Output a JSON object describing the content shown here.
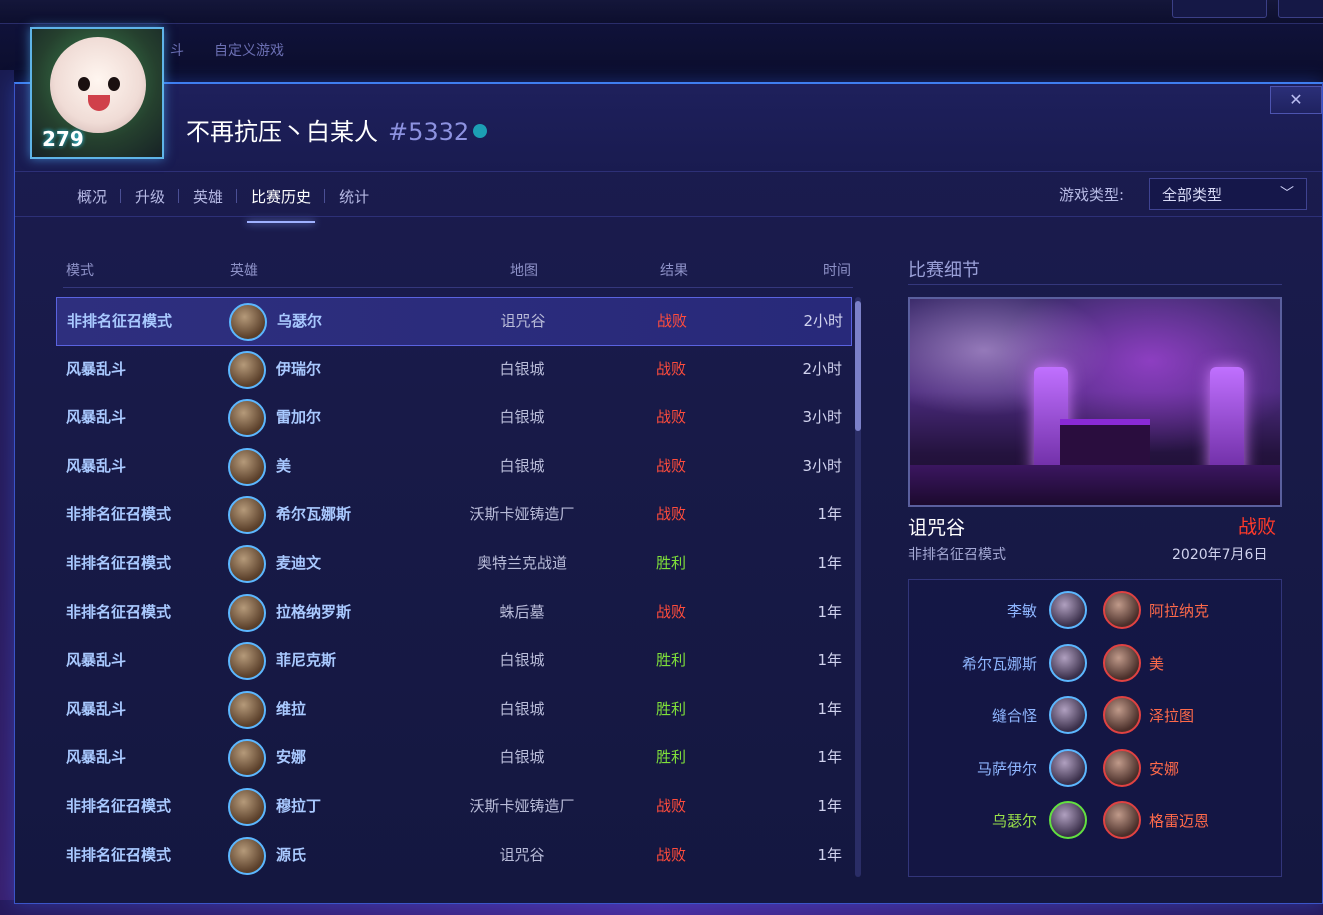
{
  "breadcrumb": [
    "斗",
    "自定义游戏"
  ],
  "player": {
    "level": "279",
    "name": "不再抗压丶白某人",
    "tag": "#5332"
  },
  "tabs": [
    {
      "label": "概况"
    },
    {
      "label": "升级"
    },
    {
      "label": "英雄"
    },
    {
      "label": "比赛历史",
      "active": true
    },
    {
      "label": "统计"
    }
  ],
  "filter": {
    "label": "游戏类型:",
    "value": "全部类型"
  },
  "table": {
    "headers": {
      "mode": "模式",
      "hero": "英雄",
      "map": "地图",
      "result": "结果",
      "time": "时间"
    },
    "rows": [
      {
        "mode": "非排名征召模式",
        "hero": "乌瑟尔",
        "map": "诅咒谷",
        "result": "战败",
        "time": "2小时"
      },
      {
        "mode": "风暴乱斗",
        "hero": "伊瑞尔",
        "map": "白银城",
        "result": "战败",
        "time": "2小时"
      },
      {
        "mode": "风暴乱斗",
        "hero": "雷加尔",
        "map": "白银城",
        "result": "战败",
        "time": "3小时"
      },
      {
        "mode": "风暴乱斗",
        "hero": "美",
        "map": "白银城",
        "result": "战败",
        "time": "3小时"
      },
      {
        "mode": "非排名征召模式",
        "hero": "希尔瓦娜斯",
        "map": "沃斯卡娅铸造厂",
        "result": "战败",
        "time": "1年"
      },
      {
        "mode": "非排名征召模式",
        "hero": "麦迪文",
        "map": "奥特兰克战道",
        "result": "胜利",
        "time": "1年"
      },
      {
        "mode": "非排名征召模式",
        "hero": "拉格纳罗斯",
        "map": "蛛后墓",
        "result": "战败",
        "time": "1年"
      },
      {
        "mode": "风暴乱斗",
        "hero": "菲尼克斯",
        "map": "白银城",
        "result": "胜利",
        "time": "1年"
      },
      {
        "mode": "风暴乱斗",
        "hero": "维拉",
        "map": "白银城",
        "result": "胜利",
        "time": "1年"
      },
      {
        "mode": "风暴乱斗",
        "hero": "安娜",
        "map": "白银城",
        "result": "胜利",
        "time": "1年"
      },
      {
        "mode": "非排名征召模式",
        "hero": "穆拉丁",
        "map": "沃斯卡娅铸造厂",
        "result": "战败",
        "time": "1年"
      },
      {
        "mode": "非排名征召模式",
        "hero": "源氏",
        "map": "诅咒谷",
        "result": "战败",
        "time": "1年"
      }
    ]
  },
  "detail": {
    "title": "比赛细节",
    "map": "诅咒谷",
    "result": "战败",
    "mode": "非排名征召模式",
    "date": "2020年7月6日",
    "allies": [
      "李敏",
      "希尔瓦娜斯",
      "缝合怪",
      "马萨伊尔",
      "乌瑟尔"
    ],
    "enemies": [
      "阿拉纳克",
      "美",
      "泽拉图",
      "安娜",
      "格雷迈恩"
    ]
  },
  "colors": {
    "loss": "#ff4c3c",
    "win": "#7fe03a",
    "accent": "#3f7ef0"
  },
  "close_label": "✕"
}
